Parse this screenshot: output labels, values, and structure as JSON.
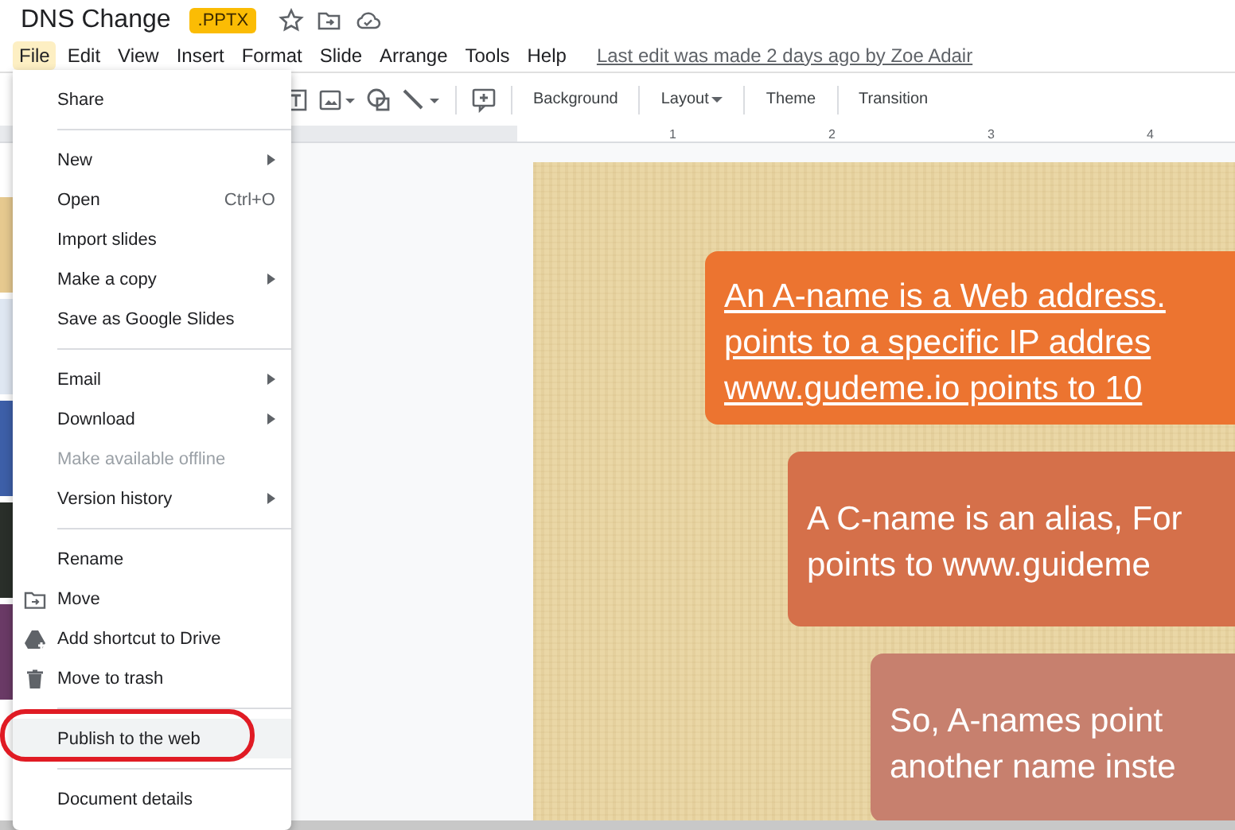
{
  "document": {
    "title": "DNS Change",
    "badge": ".PPTX",
    "last_edit": "Last edit was made 2 days ago by Zoe Adair"
  },
  "menu_bar": [
    {
      "label": "File",
      "selected": true
    },
    {
      "label": "Edit",
      "selected": false
    },
    {
      "label": "View",
      "selected": false
    },
    {
      "label": "Insert",
      "selected": false
    },
    {
      "label": "Format",
      "selected": false
    },
    {
      "label": "Slide",
      "selected": false
    },
    {
      "label": "Arrange",
      "selected": false
    },
    {
      "label": "Tools",
      "selected": false
    },
    {
      "label": "Help",
      "selected": false
    }
  ],
  "toolbar": {
    "buttons": [
      {
        "label": "Background",
        "dropdown": false
      },
      {
        "label": "Layout",
        "dropdown": true
      },
      {
        "label": "Theme",
        "dropdown": false
      },
      {
        "label": "Transition",
        "dropdown": false
      }
    ]
  },
  "ruler": {
    "marks": [
      "1",
      "2",
      "3",
      "4"
    ]
  },
  "file_menu": {
    "sections": [
      [
        {
          "label": "Share",
          "submenu": false,
          "disabled": false,
          "highlighted": false,
          "circled": false
        }
      ],
      [
        {
          "label": "New",
          "submenu": true,
          "disabled": false,
          "highlighted": false,
          "circled": false
        },
        {
          "label": "Open",
          "shortcut": "Ctrl+O",
          "submenu": false,
          "disabled": false,
          "highlighted": false,
          "circled": false
        },
        {
          "label": "Import slides",
          "submenu": false,
          "disabled": false,
          "highlighted": false,
          "circled": false
        },
        {
          "label": "Make a copy",
          "submenu": true,
          "disabled": false,
          "highlighted": false,
          "circled": false
        },
        {
          "label": "Save as Google Slides",
          "submenu": false,
          "disabled": false,
          "highlighted": false,
          "circled": false
        }
      ],
      [
        {
          "label": "Email",
          "submenu": true,
          "disabled": false,
          "highlighted": false,
          "circled": false
        },
        {
          "label": "Download",
          "submenu": true,
          "disabled": false,
          "highlighted": false,
          "circled": false
        },
        {
          "label": "Make available offline",
          "submenu": false,
          "disabled": true,
          "highlighted": false,
          "circled": false
        },
        {
          "label": "Version history",
          "submenu": true,
          "disabled": false,
          "highlighted": false,
          "circled": false
        }
      ],
      [
        {
          "label": "Rename",
          "submenu": false,
          "disabled": false,
          "highlighted": false,
          "circled": false
        },
        {
          "label": "Move",
          "submenu": false,
          "disabled": false,
          "highlighted": false,
          "circled": false
        },
        {
          "label": "Add shortcut to Drive",
          "submenu": false,
          "disabled": false,
          "highlighted": false,
          "circled": false
        },
        {
          "label": "Move to trash",
          "submenu": false,
          "disabled": false,
          "highlighted": false,
          "circled": false
        }
      ],
      [
        {
          "label": "Publish to the web",
          "submenu": false,
          "disabled": false,
          "highlighted": true,
          "circled": true
        }
      ],
      [
        {
          "label": "Document details",
          "submenu": false,
          "disabled": false,
          "highlighted": false,
          "circled": false
        }
      ]
    ]
  },
  "slide": {
    "text_boxes": [
      {
        "lines": [
          "An A-name is a Web address.",
          "points to a specific IP addres",
          "www.gudeme.io points to 10"
        ],
        "underlined": true,
        "color": "#ec7430"
      },
      {
        "lines": [
          "A C-name is an alias, For",
          "points to www.guideme"
        ],
        "underlined": false,
        "color": "#d5704a"
      },
      {
        "lines": [
          "So, A-names point",
          "another name inste"
        ],
        "underlined": false,
        "color": "#c7806e"
      }
    ]
  }
}
